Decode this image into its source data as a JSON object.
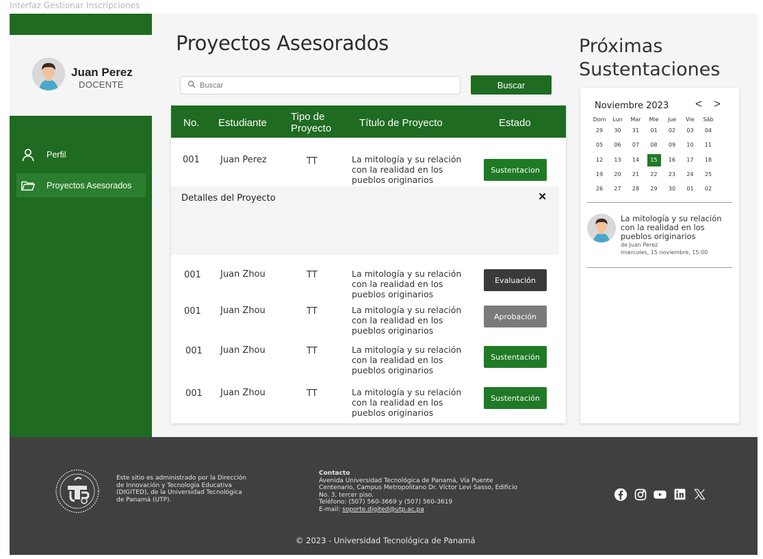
{
  "frame_label": "Interfaz Gestionar Inscripciones",
  "profile": {
    "name": "Juan Perez",
    "role": "DOCENTE"
  },
  "sidebar": {
    "items": [
      {
        "label": "Perfil",
        "icon": "user-icon",
        "active": false
      },
      {
        "label": "Proyectos Asesorados",
        "icon": "folder-open-icon",
        "active": true
      }
    ]
  },
  "main": {
    "title": "Proyectos Asesorados",
    "search": {
      "placeholder": "Buscar",
      "value": "",
      "button_label": "Buscar"
    }
  },
  "table": {
    "headers": {
      "no": "No.",
      "student": "Estudiante",
      "type": "Tipo de Proyecto",
      "title": "Título de Proyecto",
      "status": "Estado"
    },
    "rows": [
      {
        "no": "001",
        "student": "Juan Perez",
        "type": "TT",
        "title": "La mitología y su relación con la realidad en los pueblos originarios",
        "status": "Sustentacion"
      },
      {
        "no": "001",
        "student": "Juan Zhou",
        "type": "TT",
        "title": "La mitología y su relación con la realidad en los pueblos originarios",
        "status": "Evaluación"
      },
      {
        "no": "001",
        "student": "Juan Zhou",
        "type": "TT",
        "title": "La mitología y su relación con la realidad en los pueblos originarios",
        "status": "Aprobación"
      },
      {
        "no": "001",
        "student": "Juan Zhou",
        "type": "TT",
        "title": "La mitología y su relación con la realidad en los pueblos originarios",
        "status": "Sustentación"
      },
      {
        "no": "001",
        "student": "Juan Zhou",
        "type": "TT",
        "title": "La mitología y su relación con la realidad en los pueblos originarios",
        "status": "Sustentación"
      }
    ],
    "details": {
      "title": "Detalles del Proyecto",
      "close": "✕"
    }
  },
  "side": {
    "title": "Próximas Sustentaciones",
    "calendar": {
      "month": "Noviembre 2023",
      "prev": "<",
      "next": ">",
      "weekdays": [
        "Dom",
        "Lun",
        "Mar",
        "Mie",
        "Jue",
        "Vie",
        "Sáb"
      ],
      "weeks": [
        [
          "29",
          "30",
          "31",
          "01",
          "02",
          "03",
          "04"
        ],
        [
          "05",
          "06",
          "07",
          "08",
          "09",
          "10",
          "11"
        ],
        [
          "12",
          "13",
          "14",
          "15",
          "16",
          "17",
          "18"
        ],
        [
          "19",
          "20",
          "21",
          "22",
          "23",
          "24",
          "25"
        ],
        [
          "26",
          "27",
          "28",
          "29",
          "30",
          "01",
          "02"
        ]
      ],
      "selected": "15"
    },
    "event": {
      "title": "La mitología y su relación con la realidad en los pueblos originarios",
      "by": "de Juan Perez",
      "date": "miercoles, 15 noviembre, 15:00"
    }
  },
  "footer": {
    "admin_text": "Este sitio es administrado por la Dirección de Innovación y Tecnología Educativa (DIGITED), de la Universidad Tecnológica de Panamá (UTP).",
    "contact_title": "Contacto",
    "contact_lines": [
      "Avenida Universidad Tecnológica de Panamá, Vía Puente Centenario, Campus Metropolitano Dr. Víctor Levi Sasso, Edificio No. 3, tercer piso.",
      "Teléfono: (507) 560-3669 y (507) 560-3619"
    ],
    "email_label": "E-mail: ",
    "email": "soporte.digited@utp.ac.pa",
    "socials": [
      "facebook-icon",
      "instagram-icon",
      "youtube-icon",
      "linkedin-icon",
      "x-icon"
    ],
    "copyright": "© 2023 - Universidad Tecnológica de Panamá"
  },
  "colors": {
    "primary_green": "#1f6b21",
    "active_nav": "#2b7e2e",
    "status_green": "#1f7a25",
    "status_dark": "#3a3a3a",
    "status_gray": "#7a7a7a",
    "footer_bg": "#404040"
  }
}
